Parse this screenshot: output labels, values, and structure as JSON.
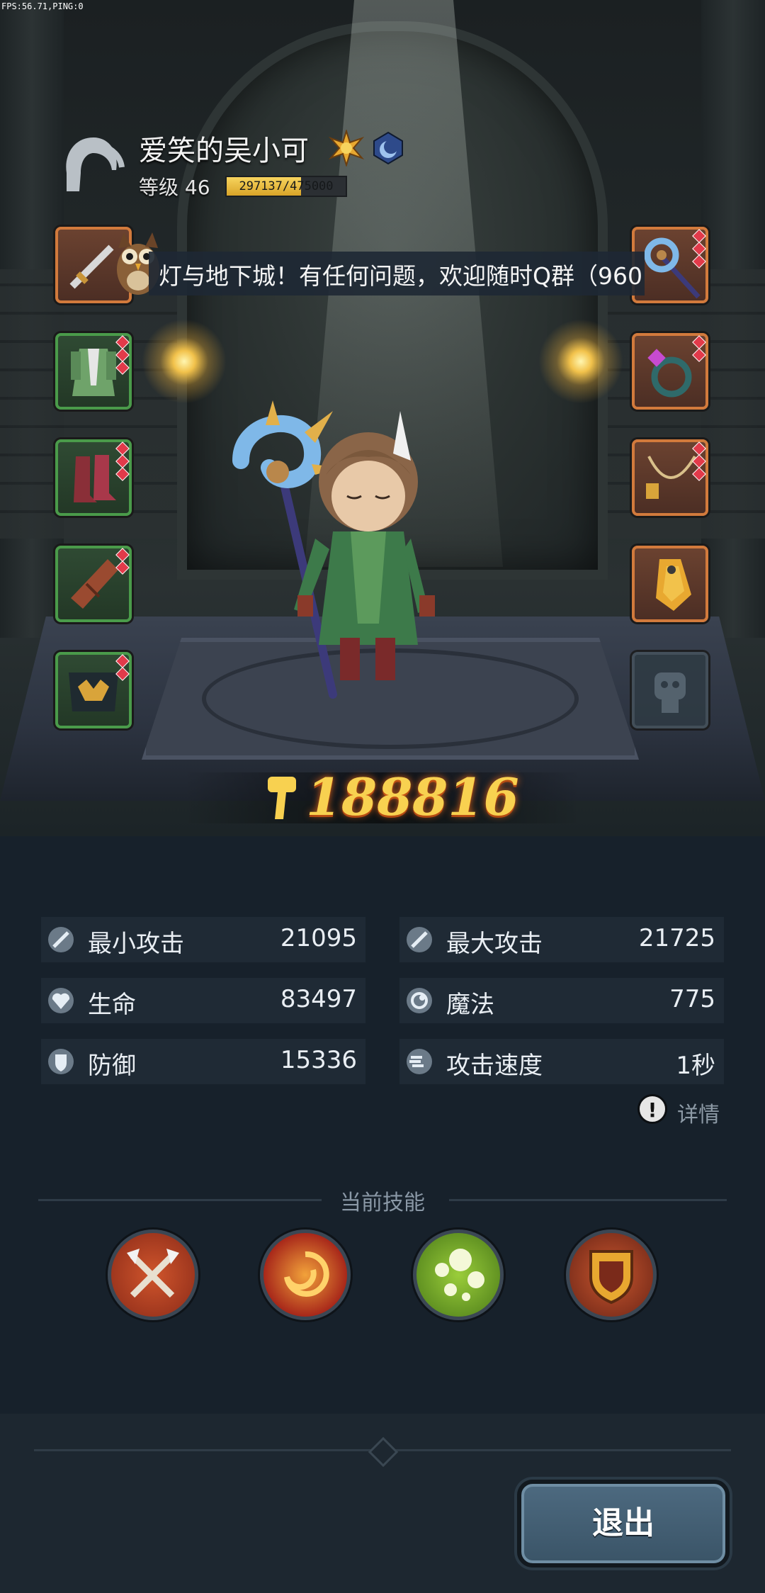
{
  "debug": {
    "fps_text": "FPS:56.71,PING:0"
  },
  "player": {
    "name": "爱笑的吴小可",
    "level_label": "等级 46",
    "xp_text": "297137/475000",
    "xp_current": 297137,
    "xp_max": 475000
  },
  "marquee": {
    "text": "灯与地下城！有任何问题，欢迎随时Q群（960"
  },
  "power": {
    "value": "188816"
  },
  "stats": {
    "min_attack": {
      "label": "最小攻击",
      "value": "21095"
    },
    "max_attack": {
      "label": "最大攻击",
      "value": "21725"
    },
    "hp": {
      "label": "生命",
      "value": "83497"
    },
    "mp": {
      "label": "魔法",
      "value": "775"
    },
    "defense": {
      "label": "防御",
      "value": "15336"
    },
    "attack_speed": {
      "label": "攻击速度",
      "value": "1秒"
    },
    "detail_label": "详情"
  },
  "skills": {
    "title": "当前技能"
  },
  "footer": {
    "exit_label": "退出"
  },
  "equipment": {
    "left": [
      "weapon-offhand",
      "chest-armor",
      "boots",
      "bracer",
      "belt"
    ],
    "right": [
      "staff",
      "ring",
      "necklace",
      "gauntlet",
      "empty"
    ]
  },
  "colors": {
    "slot_orange": "#d27a3c",
    "slot_green": "#4a9b4a",
    "power_gold": "#f8d150"
  }
}
